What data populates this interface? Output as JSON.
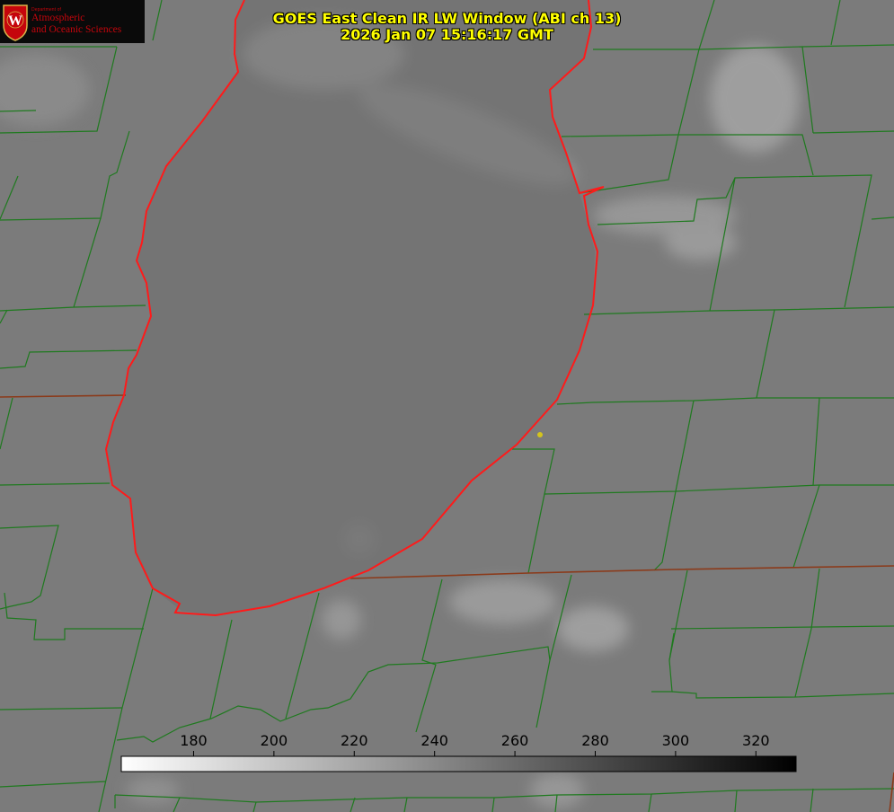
{
  "logo": {
    "department_label": "Department of",
    "line1": "Atmospheric",
    "line2": "and Oceanic Sciences",
    "seal_letter": "W"
  },
  "title": {
    "line1": "GOES East Clean IR LW Window (ABI ch 13)",
    "line2": "2026 Jan 07 15:16:17 GMT"
  },
  "colorbar": {
    "ticks": [
      180,
      200,
      220,
      240,
      260,
      280,
      300,
      320
    ],
    "min": 162,
    "max": 330,
    "gradient": [
      "#ffffff",
      "#000000"
    ]
  },
  "colors": {
    "lake_outline": "#ff1a1a",
    "boundaries": "#1f7a1f",
    "state_border": "#8b3a1a",
    "title_text": "#ffff00",
    "marker": "#d4c41c"
  }
}
